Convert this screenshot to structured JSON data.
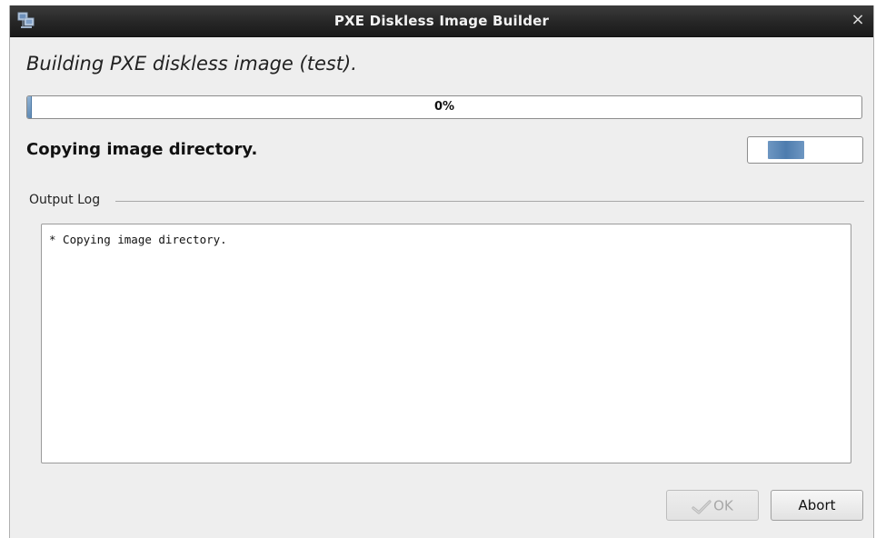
{
  "window": {
    "title": "PXE Diskless Image Builder",
    "close_glyph": "×",
    "icon": "network-computers-icon"
  },
  "main": {
    "heading": "Building PXE diskless image (test).",
    "progress": {
      "value": 0,
      "label": "0%"
    },
    "status_text": "Copying image directory.",
    "activity_indicator": "indeterminate"
  },
  "output_log": {
    "legend": "Output Log",
    "lines": [
      "* Copying image directory."
    ]
  },
  "buttons": {
    "ok_label": "OK",
    "ok_enabled": false,
    "ok_icon": "check-arrow-icon",
    "abort_label": "Abort"
  },
  "colors": {
    "titlebar": "#262626",
    "progress_accent": "#5f8ab4",
    "background": "#eeeeee"
  }
}
